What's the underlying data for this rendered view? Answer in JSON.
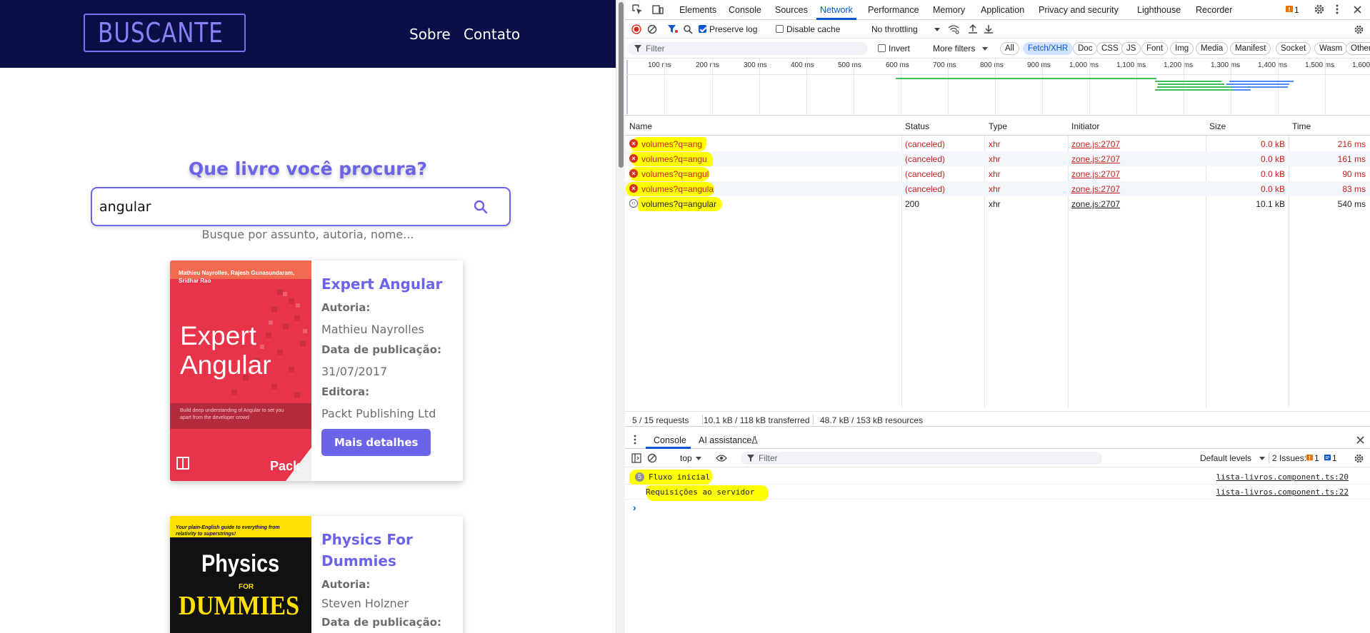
{
  "app": {
    "logo_text": "BUSCANTE",
    "nav": {
      "sobre": "Sobre",
      "contato": "Contato"
    },
    "search_title": "Que livro você procura?",
    "search_value": "angular",
    "search_hint": "Busque por assunto, autoria, nome...",
    "books": [
      {
        "title": "Expert Angular",
        "author_label": "Autoria:",
        "author": "Mathieu Nayrolles",
        "date_label": "Data de publicação:",
        "date": "31/07/2017",
        "publisher_label": "Editora:",
        "publisher": "Packt Publishing Ltd",
        "details_label": "Mais detalhes",
        "cover": {
          "authors_strip": "Mathieu Nayrolles, Rajesh Gunasundaram, Sridhar Rao",
          "title_line1": "Expert",
          "title_line2": "Angular",
          "tagline": "Build deep understanding of Angular to set you apart from the developer crowd",
          "brand": "Pack",
          "color": "#e8344a"
        }
      },
      {
        "title": "Physics For Dummies",
        "author_label": "Autoria:",
        "author": "Steven Holzner",
        "date_label": "Data de publicação:",
        "cover": {
          "strip": "Your plain-English guide to everything from relativity to superstrings!",
          "title_line1": "Physics",
          "title_for": "FOR",
          "title_line2": "DUMMIES",
          "color": "#ffe000"
        }
      }
    ]
  },
  "devtools": {
    "tabs": [
      "Elements",
      "Console",
      "Sources",
      "Network",
      "Performance",
      "Memory",
      "Application",
      "Privacy and security",
      "Lighthouse",
      "Recorder"
    ],
    "active_tab": "Network",
    "issue_count": "1",
    "toolbar": {
      "preserve_log": "Preserve log",
      "disable_cache": "Disable cache",
      "throttling": "No throttling"
    },
    "filter": {
      "placeholder": "Filter",
      "invert": "Invert",
      "more_filters": "More filters",
      "types": [
        "All",
        "Fetch/XHR",
        "Doc",
        "CSS",
        "JS",
        "Font",
        "Img",
        "Media",
        "Manifest",
        "Socket",
        "Wasm",
        "Other"
      ],
      "active_type": "Fetch/XHR"
    },
    "timeline_ticks": [
      "100 ms",
      "200 ms",
      "300 ms",
      "400 ms",
      "500 ms",
      "600 ms",
      "700 ms",
      "800 ms",
      "900 ms",
      "1,000 ms",
      "1,100 ms",
      "1,200 ms",
      "1,300 ms",
      "1,400 ms",
      "1,500 ms",
      "1,600"
    ],
    "columns": {
      "name": "Name",
      "status": "Status",
      "type": "Type",
      "initiator": "Initiator",
      "size": "Size",
      "time": "Time"
    },
    "requests": [
      {
        "name": "volumes?q=ang",
        "status": "(canceled)",
        "type": "xhr",
        "initiator": "zone.js:2707",
        "size": "0.0 kB",
        "time": "216 ms",
        "failed": true
      },
      {
        "name": "volumes?q=angu",
        "status": "(canceled)",
        "type": "xhr",
        "initiator": "zone.js:2707",
        "size": "0.0 kB",
        "time": "161 ms",
        "failed": true
      },
      {
        "name": "volumes?q=angul",
        "status": "(canceled)",
        "type": "xhr",
        "initiator": "zone.js:2707",
        "size": "0.0 kB",
        "time": "90 ms",
        "failed": true
      },
      {
        "name": "volumes?q=angula",
        "status": "(canceled)",
        "type": "xhr",
        "initiator": "zone.js:2707",
        "size": "0.0 kB",
        "time": "83 ms",
        "failed": true
      },
      {
        "name": "volumes?q=angular",
        "status": "200",
        "type": "xhr",
        "initiator": "zone.js:2707",
        "size": "10.1 kB",
        "time": "540 ms",
        "failed": false
      }
    ],
    "summary": {
      "requests": "5 / 15 requests",
      "transferred": "10.1 kB / 118 kB transferred",
      "resources": "48.7 kB / 153 kB resources"
    },
    "drawer": {
      "tabs": [
        "Console",
        "AI assistance"
      ],
      "context": "top",
      "filter_placeholder": "Filter",
      "levels": "Default levels",
      "issues_label": "2 Issues:",
      "issues_warn": "1",
      "issues_info": "1",
      "messages": [
        {
          "count": "5",
          "text": "Fluxo inicial",
          "source": "lista-livros.component.ts:20"
        },
        {
          "count": "",
          "text": "Requisições ao servidor",
          "source": "lista-livros.component.ts:22"
        }
      ],
      "prompt": "›"
    }
  }
}
